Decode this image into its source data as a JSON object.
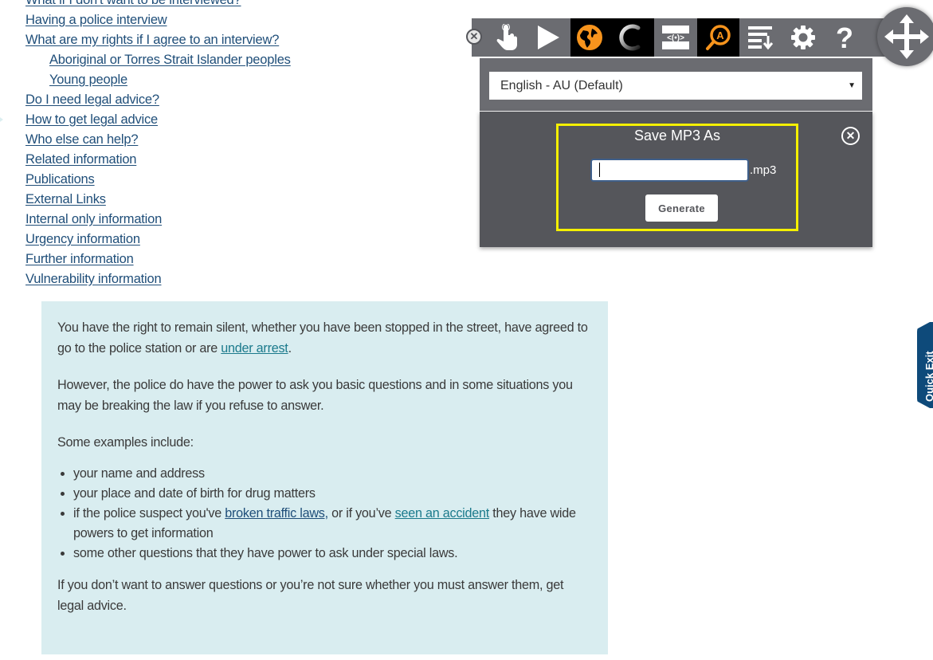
{
  "nav": {
    "links": [
      {
        "label": "What if I don't want to be interviewed?",
        "level": 0
      },
      {
        "label": "Having a police interview",
        "level": 0
      },
      {
        "label": "What are my rights if I agree to an interview?",
        "level": 0
      },
      {
        "label": "Aboriginal or Torres Strait Islander peoples",
        "level": 1
      },
      {
        "label": "Young people",
        "level": 1
      },
      {
        "label": "Do I need legal advice?",
        "level": 0
      },
      {
        "label": "How to get legal advice",
        "level": 0
      },
      {
        "label": "Who else can help?",
        "level": 0
      },
      {
        "label": "Related information",
        "level": 0
      },
      {
        "label": "Publications",
        "level": 0
      },
      {
        "label": "External Links",
        "level": 0
      },
      {
        "label": "Internal only information",
        "level": 0
      },
      {
        "label": "Urgency information",
        "level": 0
      },
      {
        "label": "Further information",
        "level": 0
      },
      {
        "label": "Vulnerability information",
        "level": 0
      }
    ]
  },
  "callout": {
    "p1_before": "You have the right to remain silent, whether you have been stopped in the street, have agreed to go to the police station or are ",
    "p1_link": "under arrest",
    "p1_after": ".",
    "p2": "However, the police do have the power to ask you basic questions and in some situations you may be breaking the law if you refuse to answer.",
    "p3": "Some examples include:",
    "bullets": {
      "b1": "your name and address",
      "b2": "your place and date of birth for drug matters",
      "b3_before": "if the police suspect you've ",
      "b3_link1": "broken traffic laws,",
      "b3_mid": " or if you’ve ",
      "b3_link2": "seen an accident",
      "b3_after": " they have wide powers to get information",
      "b4": "some other questions that they have power to ask under special laws."
    },
    "p4": "If you don’t want to answer questions or you’re not sure whether you must answer them, get legal advice."
  },
  "quick_exit": {
    "label": "Quick Exit"
  },
  "toolbar": {
    "buttons": [
      {
        "icon": "hand-pointer-icon",
        "label": "Click to speak"
      },
      {
        "icon": "play-icon",
        "label": "Play"
      },
      {
        "icon": "globe-icon",
        "label": "Translate"
      },
      {
        "icon": "loading-spinner-icon",
        "label": "Loading"
      },
      {
        "icon": "screen-mask-icon",
        "label": "Screen mask"
      },
      {
        "icon": "magnifier-text-icon",
        "label": "Text magnifier"
      },
      {
        "icon": "download-mp3-icon",
        "label": "Download MP3"
      },
      {
        "icon": "gear-icon",
        "label": "Settings"
      },
      {
        "icon": "help-icon",
        "label": "Help"
      }
    ],
    "colors": {
      "bar": "#6b6c71",
      "active": "#000000",
      "accent": "#f7941d",
      "highlight": "#f5f000"
    }
  },
  "language": {
    "selected": "English - AU (Default)"
  },
  "mp3_dialog": {
    "title": "Save MP3 As",
    "filename_value": "",
    "extension": ".mp3",
    "generate_label": "Generate"
  }
}
